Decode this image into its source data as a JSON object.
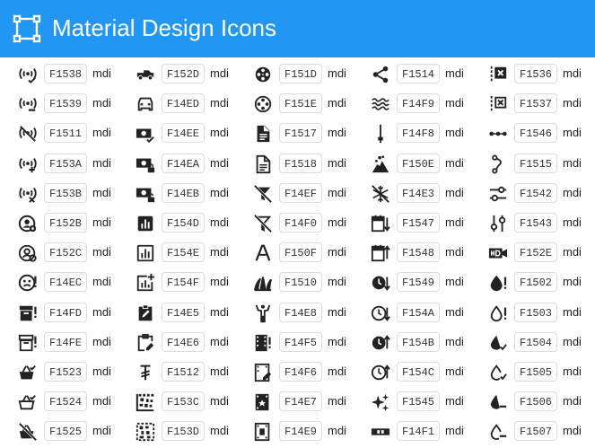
{
  "header": {
    "title": "Material Design Icons",
    "logo_icon": "bounding-box-icon",
    "bg": "#2196f3"
  },
  "columns": [
    {
      "items": [
        {
          "code": "F1538",
          "label": "mdi",
          "icon": "access-point-check-icon"
        },
        {
          "code": "F1539",
          "label": "mdi",
          "icon": "access-point-minus-icon"
        },
        {
          "code": "F1511",
          "label": "mdi",
          "icon": "access-point-off-icon"
        },
        {
          "code": "F153A",
          "label": "mdi",
          "icon": "access-point-plus-icon"
        },
        {
          "code": "F153B",
          "label": "mdi",
          "icon": "access-point-remove-icon"
        },
        {
          "code": "F152B",
          "label": "mdi",
          "icon": "account-cog-icon"
        },
        {
          "code": "F152C",
          "label": "mdi",
          "icon": "account-cog-outline-icon"
        },
        {
          "code": "F14EC",
          "label": "mdi",
          "icon": "emoticon-alert-icon"
        },
        {
          "code": "F14FD",
          "label": "mdi",
          "icon": "archive-alert-icon"
        },
        {
          "code": "F14FE",
          "label": "mdi",
          "icon": "archive-alert-outline-icon"
        },
        {
          "code": "F1523",
          "label": "mdi",
          "icon": "basket-check-icon"
        },
        {
          "code": "F1524",
          "label": "mdi",
          "icon": "basket-check-outline-icon"
        },
        {
          "code": "F1525",
          "label": "mdi",
          "icon": "basket-off-icon"
        }
      ]
    },
    {
      "items": [
        {
          "code": "F152D",
          "label": "mdi",
          "icon": "car-pickup-icon"
        },
        {
          "code": "F14ED",
          "label": "mdi",
          "icon": "car-side-icon"
        },
        {
          "code": "F14EE",
          "label": "mdi",
          "icon": "cash-check-icon"
        },
        {
          "code": "F14EA",
          "label": "mdi",
          "icon": "cash-lock-icon"
        },
        {
          "code": "F14EB",
          "label": "mdi",
          "icon": "cash-lock-open-icon"
        },
        {
          "code": "F154D",
          "label": "mdi",
          "icon": "chart-box-icon"
        },
        {
          "code": "F154E",
          "label": "mdi",
          "icon": "chart-box-outline-icon"
        },
        {
          "code": "F154F",
          "label": "mdi",
          "icon": "chart-box-plus-outline-icon"
        },
        {
          "code": "F14E5",
          "label": "mdi",
          "icon": "clipboard-edit-icon"
        },
        {
          "code": "F14E6",
          "label": "mdi",
          "icon": "clipboard-edit-outline-icon"
        },
        {
          "code": "F1512",
          "label": "mdi",
          "icon": "currency-tugrik-icon"
        },
        {
          "code": "F153C",
          "label": "mdi",
          "icon": "data-matrix-icon"
        },
        {
          "code": "F153D",
          "label": "mdi",
          "icon": "data-matrix-scan-icon"
        }
      ]
    },
    {
      "items": [
        {
          "code": "F151D",
          "label": "mdi",
          "icon": "film-reel-icon"
        },
        {
          "code": "F151E",
          "label": "mdi",
          "icon": "film-reel-outline-icon"
        },
        {
          "code": "F1517",
          "label": "mdi",
          "icon": "file-document-icon"
        },
        {
          "code": "F1518",
          "label": "mdi",
          "icon": "file-document-outline-icon"
        },
        {
          "code": "F14EF",
          "label": "mdi",
          "icon": "filter-off-icon"
        },
        {
          "code": "F14F0",
          "label": "mdi",
          "icon": "filter-off-outline-icon"
        },
        {
          "code": "F150F",
          "label": "mdi",
          "icon": "format-font-icon"
        },
        {
          "code": "F1510",
          "label": "mdi",
          "icon": "grass-icon"
        },
        {
          "code": "F14E8",
          "label": "mdi",
          "icon": "human-handsup-icon"
        },
        {
          "code": "F14F5",
          "label": "mdi",
          "icon": "film-alert-icon"
        },
        {
          "code": "F14F6",
          "label": "mdi",
          "icon": "film-edit-icon"
        },
        {
          "code": "F14E7",
          "label": "mdi",
          "icon": "film-star-icon"
        },
        {
          "code": "F14E9",
          "label": "mdi",
          "icon": "film-frame-icon"
        }
      ]
    },
    {
      "items": [
        {
          "code": "F1514",
          "label": "mdi",
          "icon": "share-variant-icon"
        },
        {
          "code": "F14F9",
          "label": "mdi",
          "icon": "waves-icon"
        },
        {
          "code": "F14F8",
          "label": "mdi",
          "icon": "needle-icon"
        },
        {
          "code": "F150E",
          "label": "mdi",
          "icon": "landslide-icon"
        },
        {
          "code": "F14E3",
          "label": "mdi",
          "icon": "snowflake-off-icon"
        },
        {
          "code": "F1547",
          "label": "mdi",
          "icon": "calendar-arrow-down-icon"
        },
        {
          "code": "F1548",
          "label": "mdi",
          "icon": "calendar-arrow-up-icon"
        },
        {
          "code": "F1549",
          "label": "mdi",
          "icon": "clock-arrow-down-icon"
        },
        {
          "code": "F154A",
          "label": "mdi",
          "icon": "clock-arrow-down-outline-icon"
        },
        {
          "code": "F154B",
          "label": "mdi",
          "icon": "clock-arrow-up-icon"
        },
        {
          "code": "F154C",
          "label": "mdi",
          "icon": "clock-arrow-up-outline-icon"
        },
        {
          "code": "F1545",
          "label": "mdi",
          "icon": "creation-icon"
        },
        {
          "code": "F14F1",
          "label": "mdi",
          "icon": "level-icon"
        }
      ]
    },
    {
      "items": [
        {
          "code": "F1536",
          "label": "mdi",
          "icon": "source-branch-remove-icon"
        },
        {
          "code": "F1537",
          "label": "mdi",
          "icon": "source-branch-remove-outline-icon"
        },
        {
          "code": "F1546",
          "label": "mdi",
          "icon": "dots-connected-icon"
        },
        {
          "code": "F1515",
          "label": "mdi",
          "icon": "curve-path-icon"
        },
        {
          "code": "F1542",
          "label": "mdi",
          "icon": "tune-horizontal-icon"
        },
        {
          "code": "F1543",
          "label": "mdi",
          "icon": "tune-vertical-icon"
        },
        {
          "code": "F152E",
          "label": "mdi",
          "icon": "video-hd-icon"
        },
        {
          "code": "F1502",
          "label": "mdi",
          "icon": "water-alert-icon"
        },
        {
          "code": "F1503",
          "label": "mdi",
          "icon": "water-alert-outline-icon"
        },
        {
          "code": "F1504",
          "label": "mdi",
          "icon": "water-check-icon"
        },
        {
          "code": "F1505",
          "label": "mdi",
          "icon": "water-check-outline-icon"
        },
        {
          "code": "F1506",
          "label": "mdi",
          "icon": "water-minus-icon"
        },
        {
          "code": "F1507",
          "label": "mdi",
          "icon": "water-minus-outline-icon"
        }
      ]
    }
  ]
}
